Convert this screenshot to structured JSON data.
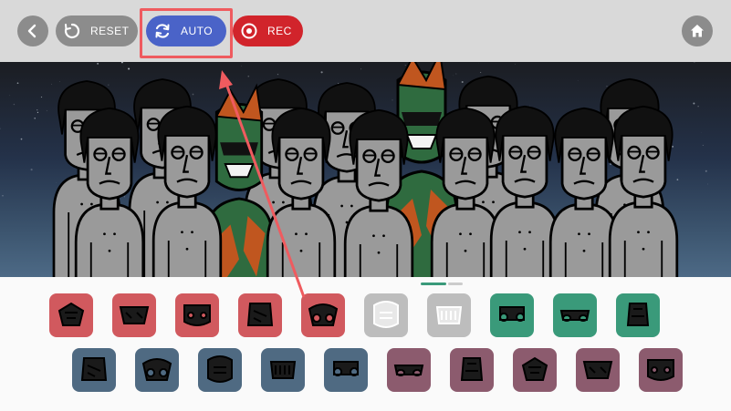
{
  "toolbar": {
    "back_icon": "chevron-left-icon",
    "reset_label": "RESET",
    "reset_icon": "reset-icon",
    "auto_label": "AUTO",
    "auto_icon": "refresh-icon",
    "rec_label": "REC",
    "rec_icon": "record-icon",
    "home_icon": "home-icon"
  },
  "colors": {
    "reset_bg": "#8c8c8c",
    "auto_bg": "#4a63c8",
    "rec_bg": "#d1242b",
    "highlight": "#ef5b5f",
    "tile_red": "#d1595e",
    "tile_gray": "#bdbdbd",
    "tile_green": "#3a9a7a",
    "tile_blue": "#4f6a82",
    "tile_mauve": "#8c5b6e"
  },
  "pager": {
    "pages": 2,
    "active": 0
  },
  "sound_palette": {
    "row1": [
      {
        "name": "beat-1",
        "color": "#d1595e"
      },
      {
        "name": "beat-2",
        "color": "#d1595e"
      },
      {
        "name": "beat-3",
        "color": "#d1595e"
      },
      {
        "name": "beat-4",
        "color": "#d1595e"
      },
      {
        "name": "beat-5",
        "color": "#d1595e"
      },
      {
        "name": "effect-1",
        "color": "#bdbdbd"
      },
      {
        "name": "effect-2",
        "color": "#bdbdbd"
      },
      {
        "name": "melody-1",
        "color": "#3a9a7a"
      },
      {
        "name": "melody-2",
        "color": "#3a9a7a"
      },
      {
        "name": "melody-3",
        "color": "#3a9a7a"
      }
    ],
    "row2": [
      {
        "name": "melody-4",
        "color": "#4f6a82"
      },
      {
        "name": "melody-5",
        "color": "#4f6a82"
      },
      {
        "name": "melody-6",
        "color": "#4f6a82"
      },
      {
        "name": "melody-7",
        "color": "#4f6a82"
      },
      {
        "name": "melody-8",
        "color": "#4f6a82"
      },
      {
        "name": "voice-1",
        "color": "#8c5b6e"
      },
      {
        "name": "voice-2",
        "color": "#8c5b6e"
      },
      {
        "name": "voice-3",
        "color": "#8c5b6e"
      },
      {
        "name": "voice-4",
        "color": "#8c5b6e"
      },
      {
        "name": "voice-5",
        "color": "#8c5b6e"
      }
    ]
  }
}
